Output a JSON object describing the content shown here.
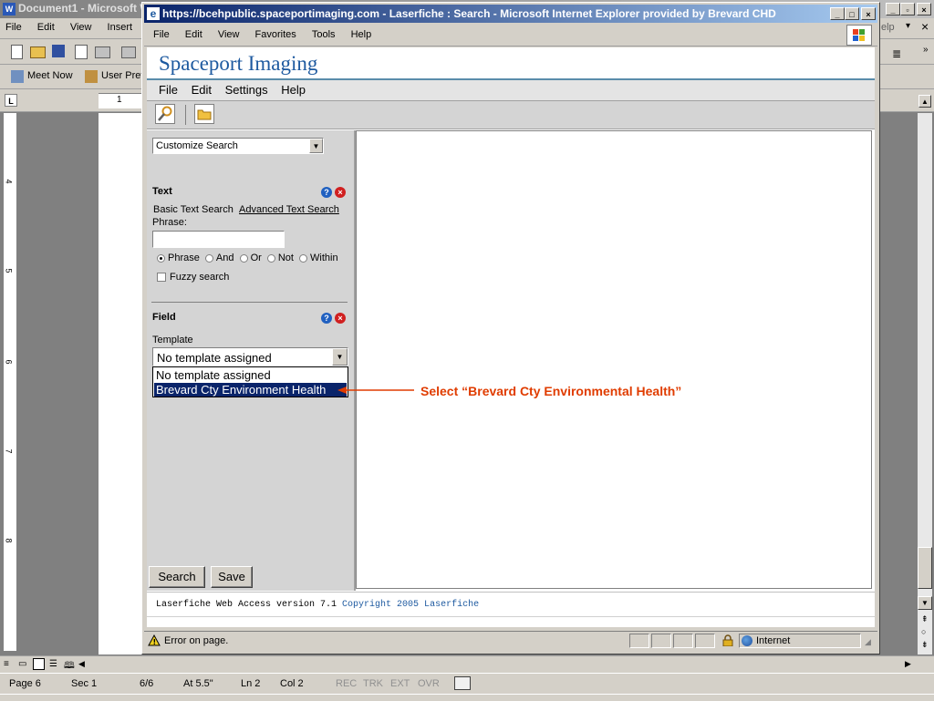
{
  "word": {
    "title": "Document1 - Microsoft W",
    "menu": [
      "File",
      "Edit",
      "View",
      "Insert"
    ],
    "right_menu_partial": "elp",
    "toolbar2": [
      "Meet Now",
      "User Pref"
    ],
    "ruler_mark": "1",
    "vruler_marks": [
      "4",
      "5",
      "6",
      "7",
      "8"
    ],
    "status": {
      "page": "Page 6",
      "sec": "Sec 1",
      "pages": "6/6",
      "at": "At 5.5\"",
      "ln": "Ln 2",
      "col": "Col 2",
      "rec": "REC",
      "trk": "TRK",
      "ext": "EXT",
      "ovr": "OVR"
    },
    "colors": {
      "workspace": "#808080",
      "chrome": "#d4d0c8",
      "title_inactive": "#808080"
    }
  },
  "ie": {
    "title": "https://bcehpublic.spaceportimaging.com - Laserfiche : Search - Microsoft Internet Explorer provided by Brevard CHD",
    "menu": [
      "File",
      "Edit",
      "View",
      "Favorites",
      "Tools",
      "Help"
    ],
    "status_text": "Error on page.",
    "zone": "Internet",
    "colors": {
      "title_active": "#0a246a",
      "title_grad": "#a6caf0"
    }
  },
  "laserfiche": {
    "brand": "Spaceport Imaging",
    "menu": [
      "File",
      "Edit",
      "Settings",
      "Help"
    ],
    "customize_select": "Customize Search",
    "text_section": {
      "title": "Text",
      "basic": "Basic Text Search",
      "advanced": "Advanced Text Search",
      "phrase_label": "Phrase:",
      "phrase_value": "",
      "radios": [
        "Phrase",
        "And",
        "Or",
        "Not",
        "Within"
      ],
      "selected_radio": "Phrase",
      "fuzzy": "Fuzzy search"
    },
    "field_section": {
      "title": "Field",
      "template_label": "Template",
      "template_selected": "No template assigned",
      "options": [
        "No template assigned",
        "Brevard Cty Environment Health"
      ],
      "highlighted_option": "Brevard Cty Environment Health"
    },
    "search_button": "Search",
    "save_button": "Save",
    "footer_prefix": "Laserfiche Web Access version 7.1 ",
    "footer_link": "Copyright 2005 Laserfiche",
    "colors": {
      "brand": "#1e5aa0",
      "panel_bg": "#d4d4d4",
      "highlight": "#0a246a"
    }
  },
  "annotation": {
    "text": "Select “Brevard Cty Environmental Health”",
    "color": "#e03c00"
  }
}
